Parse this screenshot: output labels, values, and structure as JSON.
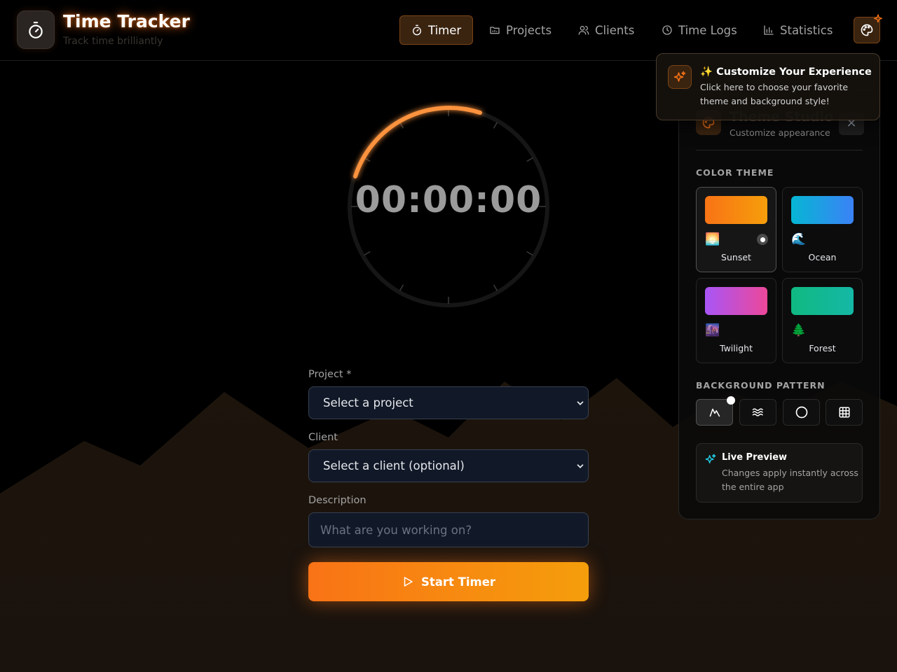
{
  "app": {
    "title": "Time Tracker",
    "subtitle": "Track time brilliantly"
  },
  "nav": {
    "items": [
      {
        "label": "Timer",
        "icon": "stopwatch-icon",
        "active": true
      },
      {
        "label": "Projects",
        "icon": "folder-icon",
        "active": false
      },
      {
        "label": "Clients",
        "icon": "users-icon",
        "active": false
      },
      {
        "label": "Time Logs",
        "icon": "clock-icon",
        "active": false
      },
      {
        "label": "Statistics",
        "icon": "bar-chart-icon",
        "active": false
      }
    ],
    "theme_button_icon": "palette-icon"
  },
  "timer": {
    "display": "00:00:00"
  },
  "form": {
    "project_label": "Project *",
    "project_value": "Select a project",
    "client_label": "Client",
    "client_value": "Select a client (optional)",
    "description_label": "Description",
    "description_placeholder": "What are you working on?",
    "start_label": "Start Timer"
  },
  "tooltip": {
    "title": "✨ Customize Your Experience",
    "text": "Click here to choose your favorite theme and background style!"
  },
  "theme_panel": {
    "title": "Theme Studio",
    "subtitle": "Customize appearance",
    "close_label": "✕",
    "color_theme_label": "COLOR THEME",
    "themes": [
      {
        "name": "Sunset",
        "emoji": "🌅",
        "from": "#f97316",
        "to": "#f59e0b",
        "selected": true
      },
      {
        "name": "Ocean",
        "emoji": "🌊",
        "from": "#06b6d4",
        "to": "#3b82f6",
        "selected": false
      },
      {
        "name": "Twilight",
        "emoji": "🌆",
        "from": "#a855f7",
        "to": "#ec4899",
        "selected": false
      },
      {
        "name": "Forest",
        "emoji": "🌲",
        "from": "#10b981",
        "to": "#14b8a6",
        "selected": false
      }
    ],
    "background_pattern_label": "BACKGROUND PATTERN",
    "patterns": [
      {
        "icon": "mountain-icon",
        "selected": true
      },
      {
        "icon": "waves-icon",
        "selected": false
      },
      {
        "icon": "circle-icon",
        "selected": false
      },
      {
        "icon": "grid-icon",
        "selected": false
      }
    ],
    "preview_title": "Live Preview",
    "preview_text": "Changes apply instantly across the entire app"
  },
  "colors": {
    "accent": "#f97316",
    "accent_2": "#f59e0b",
    "background": "#000000"
  }
}
